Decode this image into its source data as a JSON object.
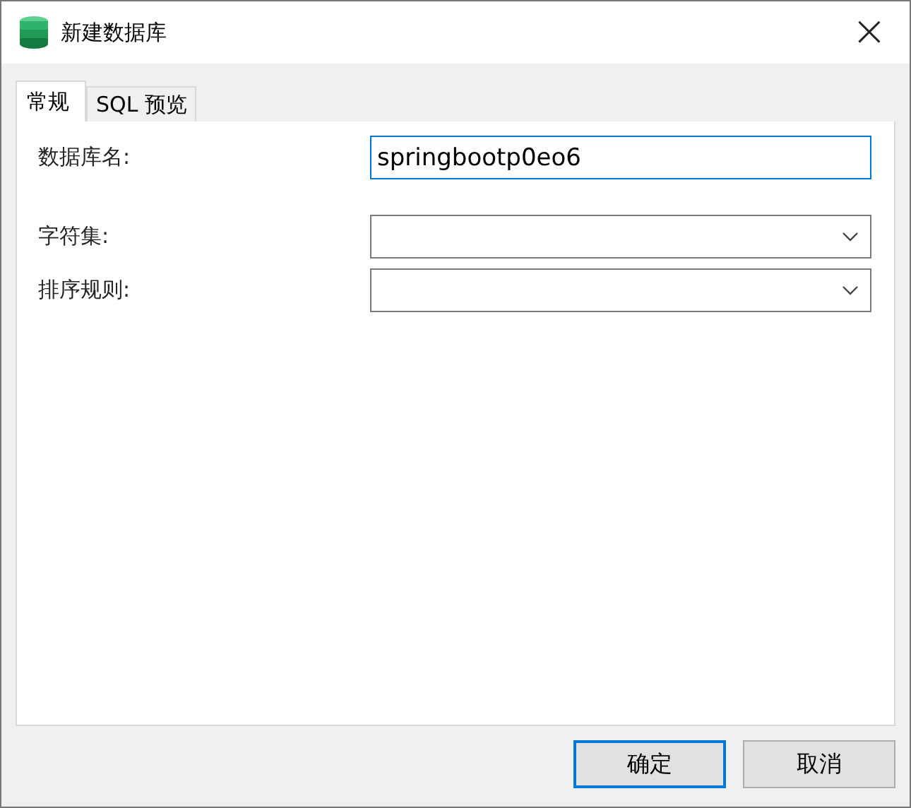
{
  "window": {
    "title": "新建数据库",
    "close": "×"
  },
  "tabs": [
    {
      "label": "常规",
      "selected": true
    },
    {
      "label": "SQL 预览",
      "selected": false
    }
  ],
  "fields": [
    {
      "kind": "text",
      "label": "数据库名:",
      "value": "springbootp0eo6",
      "focused": true
    },
    {
      "kind": "select",
      "label": "字符集:",
      "focused": false
    },
    {
      "kind": "select",
      "label": "排序规则:",
      "focused": false
    }
  ],
  "buttons": [
    {
      "label": "确定",
      "focused": true
    },
    {
      "label": "取消",
      "focused": false
    }
  ]
}
